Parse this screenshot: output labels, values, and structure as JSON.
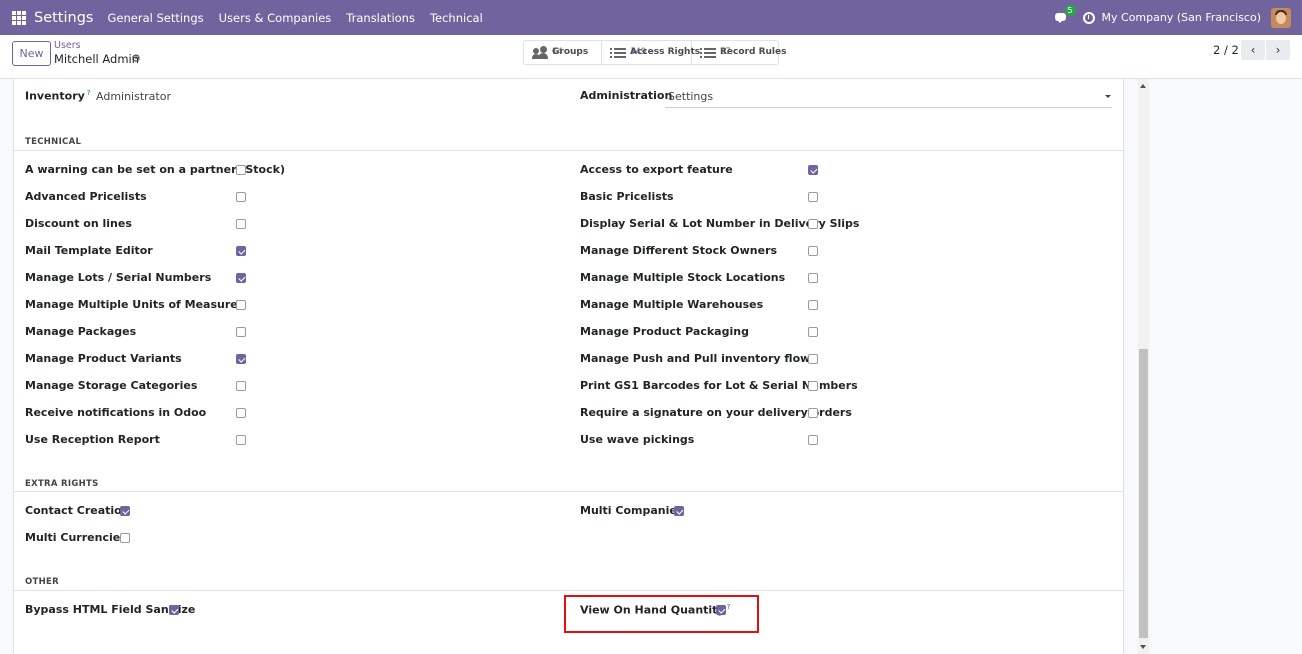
{
  "navbar": {
    "app_name": "Settings",
    "menu": [
      "General Settings",
      "Users & Companies",
      "Translations",
      "Technical"
    ],
    "messages_badge": "5",
    "company": "My Company (San Francisco)"
  },
  "control": {
    "new_label": "New",
    "breadcrumb_parent": "Users",
    "breadcrumb_current": "Mitchell Admin",
    "smart_buttons": [
      {
        "label": "Groups",
        "count": "14",
        "icon": "users-icon"
      },
      {
        "label": "Access Rights",
        "count": "349",
        "icon": "list-icon"
      },
      {
        "label": "Record Rules",
        "count": "37",
        "icon": "list-icon"
      }
    ],
    "pager": "2 / 2"
  },
  "top_fields": {
    "inventory_label": "Inventory",
    "inventory_help": "?",
    "inventory_value": "Administrator",
    "administration_label": "Administration",
    "administration_value": "Settings"
  },
  "technical": {
    "title": "TECHNICAL",
    "left": [
      {
        "label": "A warning can be set on a partner (Stock)",
        "checked": false
      },
      {
        "label": "Advanced Pricelists",
        "checked": false
      },
      {
        "label": "Discount on lines",
        "checked": false
      },
      {
        "label": "Mail Template Editor",
        "checked": true
      },
      {
        "label": "Manage Lots / Serial Numbers",
        "checked": true
      },
      {
        "label": "Manage Multiple Units of Measure",
        "checked": false
      },
      {
        "label": "Manage Packages",
        "checked": false
      },
      {
        "label": "Manage Product Variants",
        "checked": true
      },
      {
        "label": "Manage Storage Categories",
        "checked": false
      },
      {
        "label": "Receive notifications in Odoo",
        "checked": false
      },
      {
        "label": "Use Reception Report",
        "checked": false
      }
    ],
    "right": [
      {
        "label": "Access to export feature",
        "checked": true
      },
      {
        "label": "Basic Pricelists",
        "checked": false
      },
      {
        "label": "Display Serial & Lot Number in Delivery Slips",
        "checked": false
      },
      {
        "label": "Manage Different Stock Owners",
        "checked": false
      },
      {
        "label": "Manage Multiple Stock Locations",
        "checked": false
      },
      {
        "label": "Manage Multiple Warehouses",
        "checked": false
      },
      {
        "label": "Manage Product Packaging",
        "checked": false
      },
      {
        "label": "Manage Push and Pull inventory flows",
        "checked": false
      },
      {
        "label": "Print GS1 Barcodes for Lot & Serial Numbers",
        "checked": false
      },
      {
        "label": "Require a signature on your delivery orders",
        "checked": false
      },
      {
        "label": "Use wave pickings",
        "checked": false
      }
    ]
  },
  "extra_rights": {
    "title": "EXTRA RIGHTS",
    "contact_creation": {
      "label": "Contact Creation",
      "checked": true
    },
    "multi_currencies": {
      "label": "Multi Currencies",
      "checked": false
    },
    "multi_companies": {
      "label": "Multi Companies",
      "checked": true
    }
  },
  "other": {
    "title": "OTHER",
    "bypass_html": {
      "label": "Bypass HTML Field Sanitize",
      "checked": true
    },
    "view_on_hand": {
      "label": "View On Hand Quantity",
      "help": "?",
      "checked": true
    }
  },
  "colors": {
    "brand": "#71639e",
    "highlight": "#e01010"
  }
}
